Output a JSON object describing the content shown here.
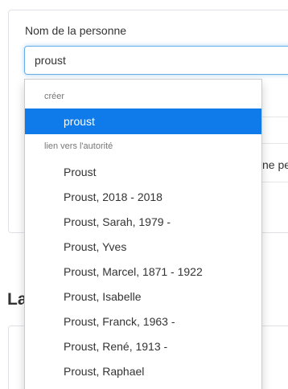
{
  "form": {
    "field_label": "Nom de la personne",
    "input_value": "proust"
  },
  "background": {
    "partial_text": "ne pe",
    "section_heading_partial": "La"
  },
  "dropdown": {
    "create_header": "créer",
    "create_option": "proust",
    "link_header": "lien vers l'autorité",
    "authorities": [
      "Proust",
      "Proust, 2018 - 2018",
      "Proust, Sarah, 1979 -",
      "Proust, Yves",
      "Proust, Marcel, 1871 - 1922",
      "Proust, Isabelle",
      "Proust, Franck, 1963 -",
      "Proust, René, 1913 -",
      "Proust, Raphael"
    ]
  },
  "colors": {
    "active_item": "#0f7bea",
    "input_focus": "#66afe9",
    "success_green": "#5cb85c"
  }
}
